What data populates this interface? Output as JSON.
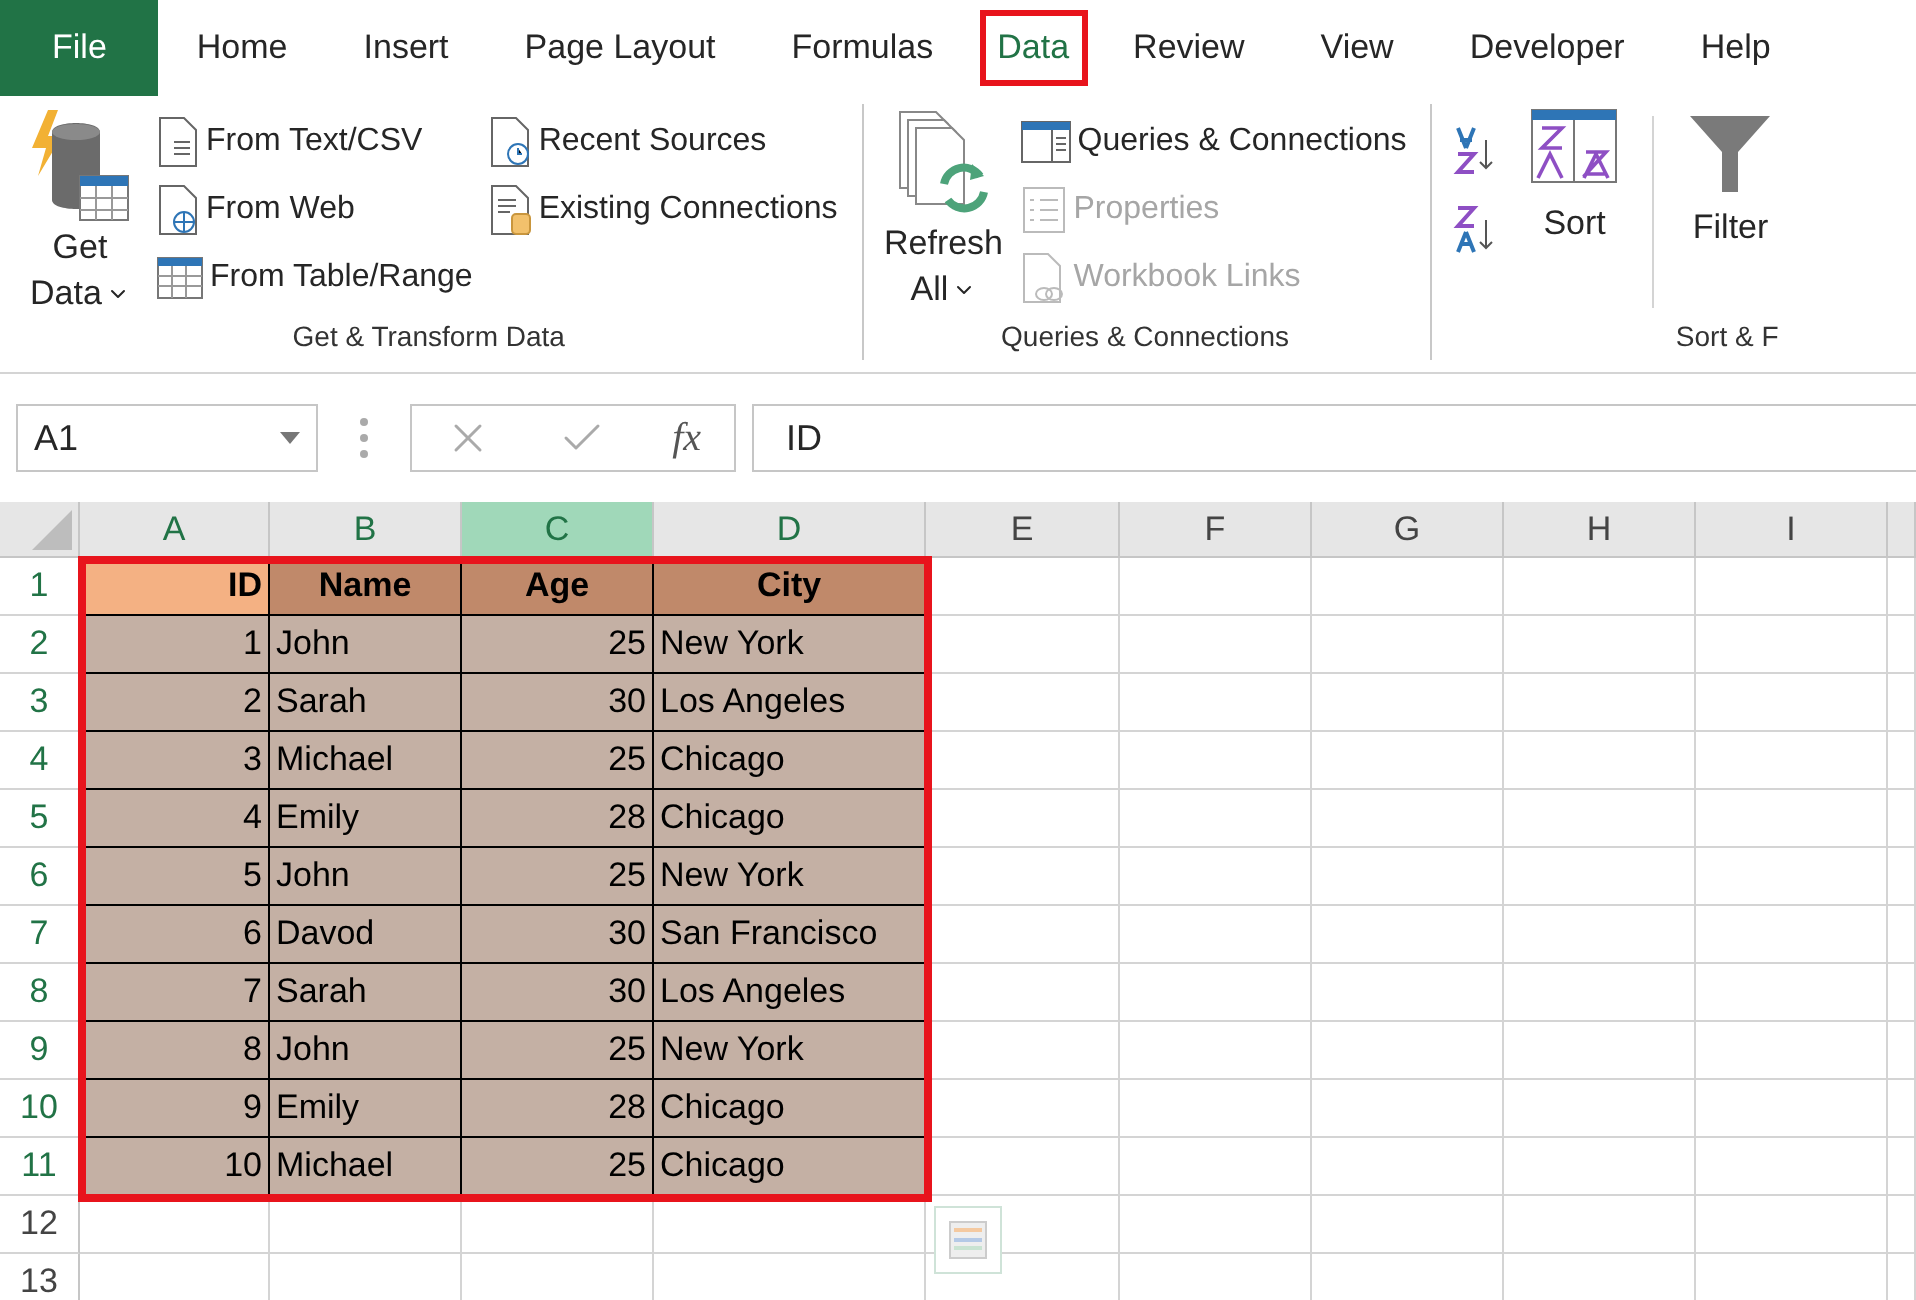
{
  "ribbon_tabs": [
    {
      "label": "File",
      "kind": "file",
      "selected": false
    },
    {
      "label": "Home",
      "kind": "tab",
      "selected": false
    },
    {
      "label": "Insert",
      "kind": "tab",
      "selected": false
    },
    {
      "label": "Page Layout",
      "kind": "tab",
      "selected": false
    },
    {
      "label": "Formulas",
      "kind": "tab",
      "selected": false
    },
    {
      "label": "Data",
      "kind": "tab",
      "selected": true
    },
    {
      "label": "Review",
      "kind": "tab",
      "selected": false
    },
    {
      "label": "View",
      "kind": "tab",
      "selected": false
    },
    {
      "label": "Developer",
      "kind": "tab",
      "selected": false
    },
    {
      "label": "Help",
      "kind": "tab",
      "selected": false
    }
  ],
  "ribbon": {
    "groups": [
      {
        "kind": "commands",
        "label": "Get & Transform Data",
        "big_button": [
          "Get",
          "Data"
        ],
        "columns": [
          [
            {
              "label": "From Text/CSV",
              "disabled": false
            },
            {
              "label": "From Web",
              "disabled": false
            },
            {
              "label": "From Table/Range",
              "disabled": false
            }
          ],
          [
            {
              "label": "Recent Sources",
              "disabled": false
            },
            {
              "label": "Existing Connections",
              "disabled": false
            }
          ]
        ]
      },
      {
        "kind": "commands",
        "label": "Queries & Connections",
        "big_button": [
          "Refresh",
          "All"
        ],
        "columns": [
          [
            {
              "label": "Queries & Connections",
              "disabled": false
            },
            {
              "label": "Properties",
              "disabled": true
            },
            {
              "label": "Workbook Links",
              "disabled": true
            }
          ]
        ]
      },
      {
        "kind": "sort",
        "label": "Sort & F",
        "sort_label": "Sort",
        "filter_label": "Filter"
      }
    ]
  },
  "formula_bar": {
    "name_box": "A1",
    "function_label": "fx",
    "formula": "ID"
  },
  "sheet": {
    "columns": [
      {
        "label": "A",
        "selected": true,
        "active": false
      },
      {
        "label": "B",
        "selected": true,
        "active": false
      },
      {
        "label": "C",
        "selected": true,
        "active": true
      },
      {
        "label": "D",
        "selected": true,
        "active": false
      },
      {
        "label": "E",
        "selected": false,
        "active": false
      },
      {
        "label": "F",
        "selected": false,
        "active": false
      },
      {
        "label": "G",
        "selected": false,
        "active": false
      },
      {
        "label": "H",
        "selected": false,
        "active": false
      },
      {
        "label": "I",
        "selected": false,
        "active": false
      }
    ],
    "row_numbers": [
      {
        "label": "1",
        "selected": true
      },
      {
        "label": "2",
        "selected": true
      },
      {
        "label": "3",
        "selected": true
      },
      {
        "label": "4",
        "selected": true
      },
      {
        "label": "5",
        "selected": true
      },
      {
        "label": "6",
        "selected": true
      },
      {
        "label": "7",
        "selected": true
      },
      {
        "label": "8",
        "selected": true
      },
      {
        "label": "9",
        "selected": true
      },
      {
        "label": "10",
        "selected": true
      },
      {
        "label": "11",
        "selected": true
      },
      {
        "label": "12",
        "selected": false
      },
      {
        "label": "13",
        "selected": false
      }
    ],
    "table": {
      "header": [
        {
          "text": "ID",
          "kind": "number",
          "selected": true
        },
        {
          "text": "Name",
          "kind": "text",
          "selected": false
        },
        {
          "text": "Age",
          "kind": "number",
          "selected": false
        },
        {
          "text": "City",
          "kind": "text",
          "selected": false
        }
      ],
      "rows": [
        [
          "1",
          "John",
          "25",
          "New York"
        ],
        [
          "2",
          "Sarah",
          "30",
          "Los Angeles"
        ],
        [
          "3",
          "Michael",
          "25",
          "Chicago"
        ],
        [
          "4",
          "Emily",
          "28",
          "Chicago"
        ],
        [
          "5",
          "John",
          "25",
          "New York"
        ],
        [
          "6",
          "Davod",
          "30",
          "San Francisco"
        ],
        [
          "7",
          "Sarah",
          "30",
          "Los Angeles"
        ],
        [
          "8",
          "John",
          "25",
          "New York"
        ],
        [
          "9",
          "Emily",
          "28",
          "Chicago"
        ],
        [
          "10",
          "Michael",
          "25",
          "Chicago"
        ]
      ]
    }
  }
}
